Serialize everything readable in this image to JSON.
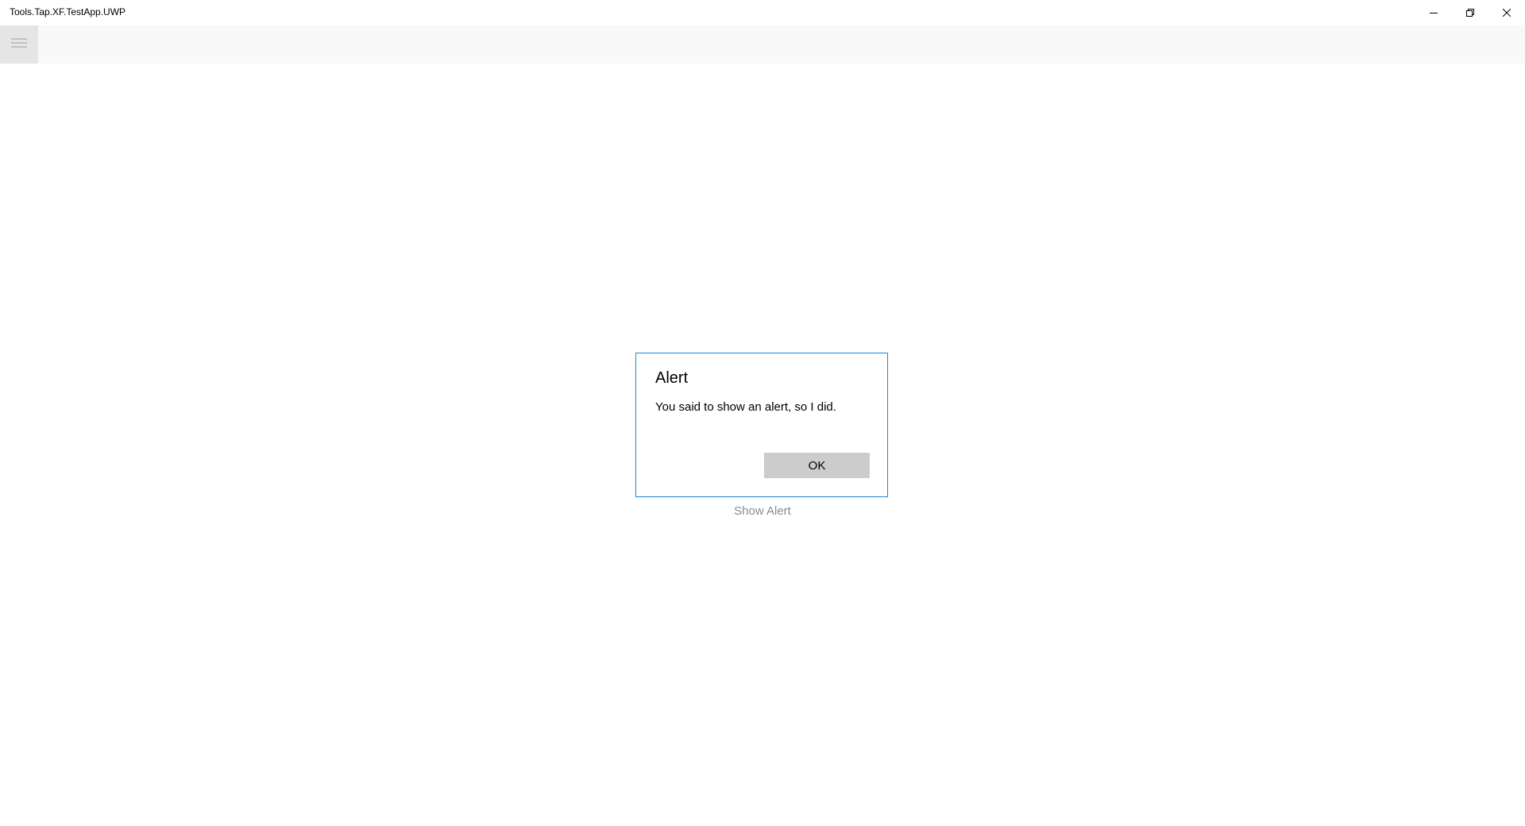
{
  "window": {
    "title": "Tools.Tap.XF.TestApp.UWP"
  },
  "caption_buttons": {
    "minimize_icon": "minimize-icon",
    "restore_icon": "restore-icon",
    "close_icon": "close-icon"
  },
  "appbar": {
    "menu_icon": "hamburger-menu-icon"
  },
  "main": {
    "show_alert_label": "Show Alert"
  },
  "dialog": {
    "title": "Alert",
    "message": "You said to show an alert, so I did.",
    "ok_label": "OK"
  },
  "colors": {
    "dialog_border": "#1a86d9",
    "ok_button_bg": "#cccccc",
    "appbar_bg": "#f9f9f9",
    "hamburger_bg": "#e5e5e5",
    "disabled_text": "#8a8a8a"
  }
}
